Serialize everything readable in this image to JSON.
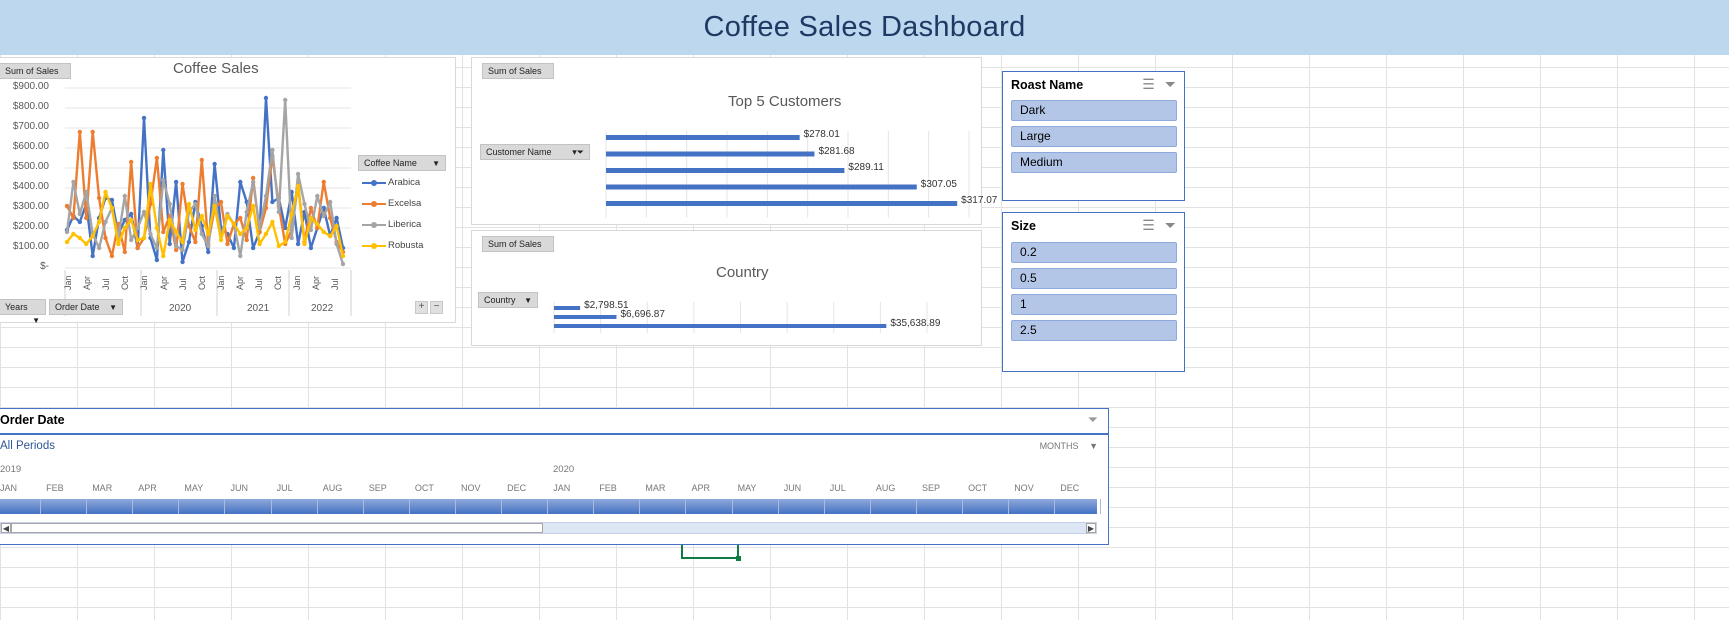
{
  "dashboard": {
    "title": "Coffee Sales Dashboard"
  },
  "sales_chart": {
    "title": "Coffee Sales",
    "field_button": "Sum of Sales",
    "legend_button": "Coffee Name",
    "axis_buttons": [
      "Years",
      "Order Date"
    ],
    "y_ticks": [
      "$900.00",
      "$800.00",
      "$700.00",
      "$600.00",
      "$500.00",
      "$400.00",
      "$300.00",
      "$200.00",
      "$100.00",
      "$-"
    ],
    "x_months": [
      "Jan",
      "Apr",
      "Jul",
      "Oct",
      "Jan",
      "Apr",
      "Jul",
      "Oct",
      "Jan",
      "Apr",
      "Jul",
      "Oct",
      "Jan",
      "Apr",
      "Jul"
    ],
    "x_years": [
      "2020",
      "2021",
      "2022"
    ],
    "legend": [
      {
        "name": "Arabica",
        "color": "#4472c4"
      },
      {
        "name": "Excelsa",
        "color": "#ed7d31"
      },
      {
        "name": "Liberica",
        "color": "#a5a5a5"
      },
      {
        "name": "Robusta",
        "color": "#ffc000"
      }
    ]
  },
  "customers_chart": {
    "title": "Top 5 Customers",
    "field_button": "Sum of Sales",
    "axis_button": "Customer Name",
    "color": "#4472c4"
  },
  "country_chart": {
    "title": "Country",
    "field_button": "Sum of Sales",
    "axis_button": "Country",
    "color": "#4472c4"
  },
  "slicers": {
    "roast": {
      "title": "Roast Name",
      "items": [
        "Dark",
        "Large",
        "Medium"
      ]
    },
    "size": {
      "title": "Size",
      "items": [
        "0.2",
        "0.5",
        "1",
        "2.5"
      ]
    }
  },
  "timeline": {
    "title": "Order Date",
    "period_label": "All Periods",
    "level": "MONTHS",
    "years": [
      "2019",
      "2020"
    ],
    "months": [
      "JAN",
      "FEB",
      "MAR",
      "APR",
      "MAY",
      "JUN",
      "JUL",
      "AUG",
      "SEP",
      "OCT",
      "NOV",
      "DEC",
      "JAN",
      "FEB",
      "MAR",
      "APR",
      "MAY",
      "JUN",
      "JUL",
      "AUG",
      "SEP",
      "OCT",
      "NOV",
      "DEC"
    ]
  },
  "chart_data": [
    {
      "type": "line",
      "title": "Coffee Sales",
      "ylim": [
        0,
        900
      ],
      "x": [
        "2019-01",
        "2019-02",
        "2019-03",
        "2019-04",
        "2019-05",
        "2019-06",
        "2019-07",
        "2019-08",
        "2019-09",
        "2019-10",
        "2019-11",
        "2019-12",
        "2020-01",
        "2020-02",
        "2020-03",
        "2020-04",
        "2020-05",
        "2020-06",
        "2020-07",
        "2020-08",
        "2020-09",
        "2020-10",
        "2020-11",
        "2020-12",
        "2021-01",
        "2021-02",
        "2021-03",
        "2021-04",
        "2021-05",
        "2021-06",
        "2021-07",
        "2021-08",
        "2021-09",
        "2021-10",
        "2021-11",
        "2021-12",
        "2022-01",
        "2022-02",
        "2022-03",
        "2022-04",
        "2022-05",
        "2022-06",
        "2022-07",
        "2022-08"
      ],
      "series": [
        {
          "name": "Arabica",
          "values": [
            190,
            260,
            230,
            320,
            60,
            250,
            350,
            340,
            170,
            240,
            270,
            100,
            750,
            150,
            40,
            590,
            120,
            430,
            30,
            130,
            330,
            210,
            80,
            520,
            200,
            170,
            100,
            430,
            330,
            100,
            180,
            850,
            330,
            350,
            200,
            380,
            120,
            280,
            100,
            200,
            300,
            160,
            250,
            100
          ]
        },
        {
          "name": "Excelsa",
          "values": [
            310,
            250,
            680,
            250,
            680,
            350,
            150,
            60,
            220,
            80,
            530,
            100,
            150,
            320,
            550,
            180,
            260,
            90,
            420,
            210,
            130,
            540,
            120,
            300,
            330,
            120,
            220,
            250,
            140,
            450,
            180,
            300,
            560,
            310,
            120,
            190,
            420,
            130,
            300,
            200,
            430,
            250,
            130,
            80
          ]
        },
        {
          "name": "Liberica",
          "values": [
            180,
            430,
            270,
            380,
            170,
            100,
            230,
            300,
            150,
            360,
            140,
            200,
            280,
            170,
            100,
            440,
            320,
            110,
            90,
            280,
            320,
            170,
            110,
            360,
            160,
            270,
            220,
            60,
            280,
            430,
            200,
            360,
            590,
            280,
            840,
            150,
            470,
            320,
            190,
            360,
            260,
            330,
            120,
            20
          ]
        },
        {
          "name": "Robusta",
          "values": [
            130,
            170,
            150,
            120,
            160,
            230,
            380,
            300,
            120,
            200,
            240,
            140,
            150,
            420,
            200,
            60,
            240,
            180,
            130,
            320,
            190,
            260,
            170,
            310,
            140,
            260,
            220,
            170,
            200,
            310,
            120,
            170,
            230,
            110,
            130,
            270,
            410,
            120,
            250,
            220,
            180,
            160,
            210,
            60
          ]
        }
      ]
    },
    {
      "type": "bar",
      "title": "Top 5 Customers",
      "categories": [
        "",
        "",
        "",
        "",
        ""
      ],
      "values": [
        278.01,
        281.68,
        289.11,
        307.05,
        317.07
      ],
      "data_labels": [
        "$278.01",
        "$281.68",
        "$289.11",
        "$307.05",
        "$317.07"
      ],
      "xlim": [
        230,
        320
      ]
    },
    {
      "type": "bar",
      "title": "Country",
      "categories": [
        "",
        "",
        ""
      ],
      "values": [
        2798.51,
        6696.87,
        35638.89
      ],
      "data_labels": [
        "$2,798.51",
        "$6,696.87",
        "$35,638.89"
      ],
      "xlim": [
        0,
        40000
      ]
    }
  ]
}
